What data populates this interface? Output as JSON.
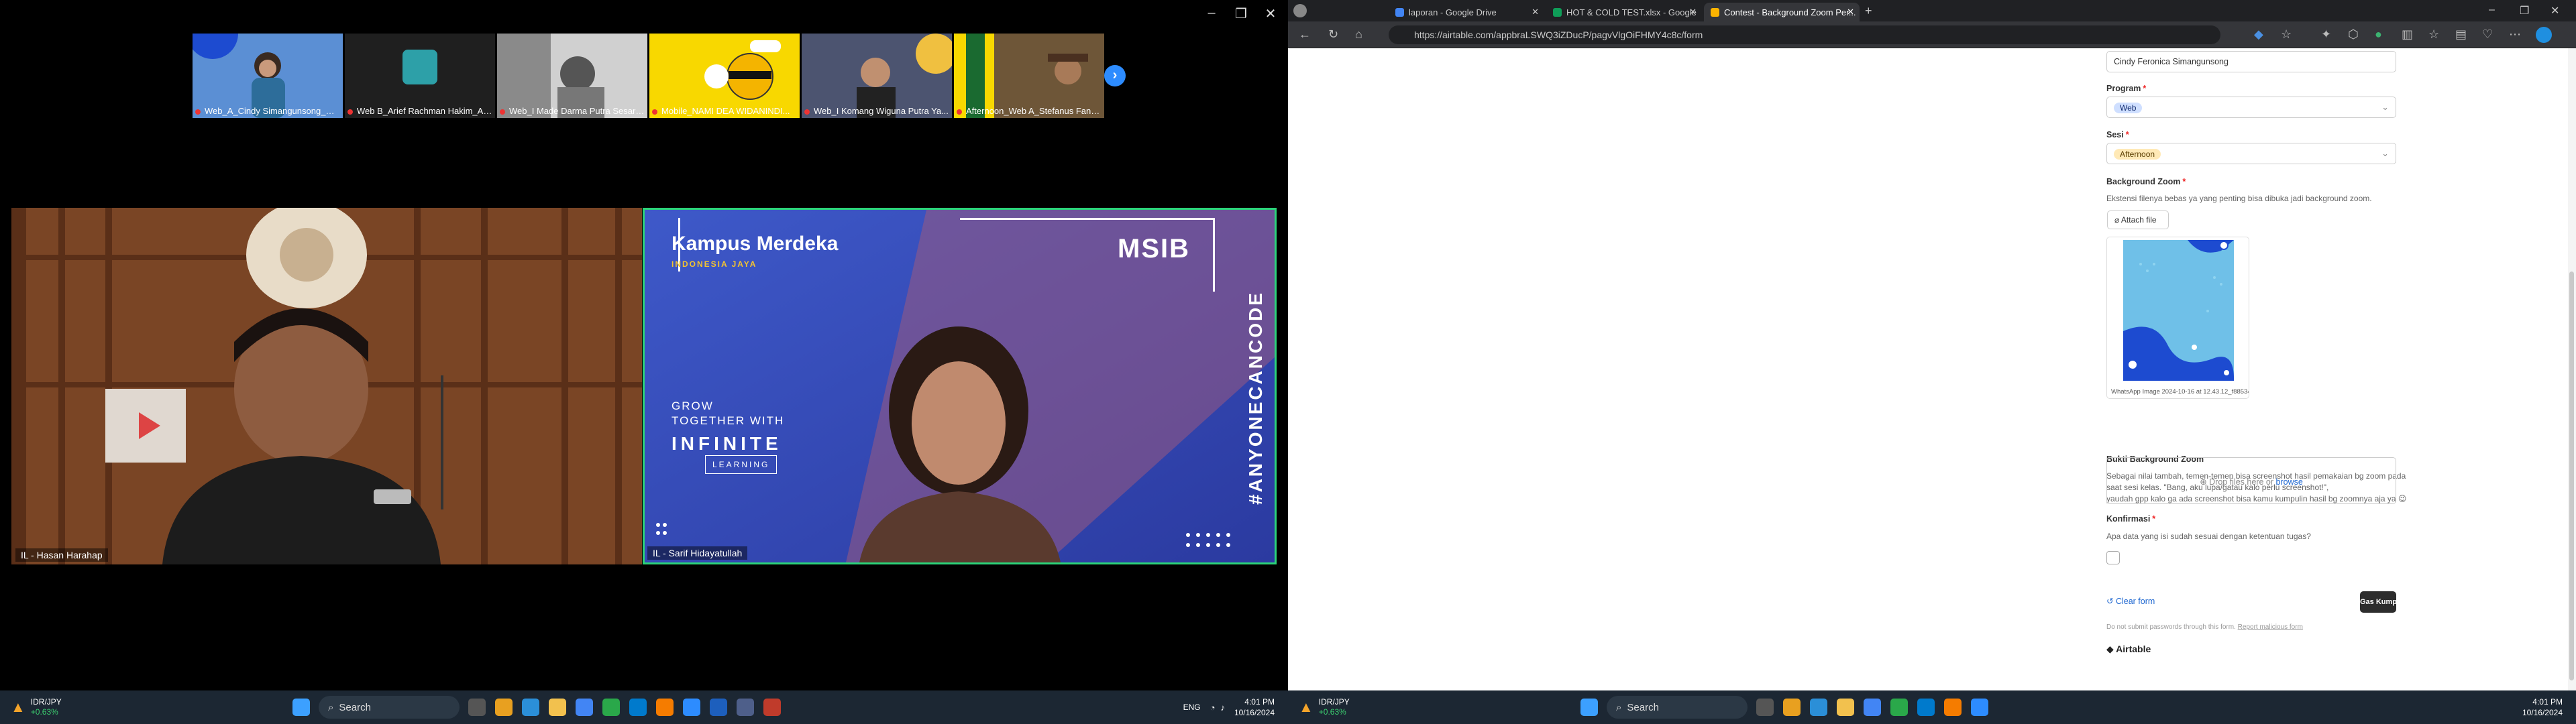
{
  "zoom": {
    "participants": [
      {
        "name": "Web_A_Cindy Simangunsong_Aft..."
      },
      {
        "name": "Web B_Arief Rachman Hakim_Aft..."
      },
      {
        "name": "Web_I Made Darma Putra Sesari..."
      },
      {
        "name": "Mobile_NAMI DEA WIDANINDI..."
      },
      {
        "name": "Web_I Komang Wiguna Putra Ya..."
      },
      {
        "name": "Afternoon_Web A_Stefanus Fandi..."
      }
    ],
    "left_speaker": "IL - Hasan Harahap",
    "right_speaker": "IL - Sarif Hidayatullah",
    "slide": {
      "brand_top": "Kampus Merdeka",
      "brand_sub": "INDONESIA JAYA",
      "msib": "MSIB",
      "grow": "GROW",
      "together": "TOGETHER WITH",
      "infinite": "INFINITE",
      "learning": "LEARNING",
      "hashtag": "#ANYONECANCODE"
    },
    "nameplate": "Hasan Harahap"
  },
  "taskbar_left": {
    "ticker": "IDR/JPY",
    "change": "+0.63%",
    "search": "Search",
    "lang": "ENG",
    "time": "4:01 PM",
    "date": "10/16/2024"
  },
  "taskbar_right": {
    "ticker": "IDR/JPY",
    "change": "+0.63%",
    "search": "Search",
    "time": "4:01 PM",
    "date": "10/16/2024"
  },
  "browser": {
    "tabs": [
      {
        "title": "laporan - Google Drive",
        "active": false,
        "color": "#4285f4"
      },
      {
        "title": "HOT & COLD TEST.xlsx - Google",
        "active": false,
        "color": "#0f9d58"
      },
      {
        "title": "Contest - Background Zoom Per...",
        "active": true,
        "color": "#fcb400"
      }
    ],
    "url": "https://airtable.com/appbraLSWQ3iZDucP/pagvVlgOiFHMY4c8c/form"
  },
  "form": {
    "name_value": "Cindy Feronica Simangunsong",
    "program_label": "Program",
    "program_value": "Web",
    "sesi_label": "Sesi",
    "sesi_value": "Afternoon",
    "bgzoom_label": "Background Zoom",
    "bgzoom_desc": "Ekstensi filenya bebas ya yang penting bisa dibuka jadi background zoom.",
    "attach_label": "Attach file",
    "attachment_name": "WhatsApp Image 2024-10-16 at 12.43.12_f8853448.jpg",
    "bukti_label": "Bukti Background Zoom",
    "bukti_desc1": "Sebagai nilai tambah, temen-temen bisa screenshot hasil pemakaian bg zoom pada saat sesi kelas. \"Bang, aku lupa/gatau kalo perlu screenshot!\",",
    "bukti_desc2": "yaudah gpp kalo ga ada screenshot bisa kamu kumpulin hasil bg zoomnya aja ya 😉",
    "drop_text": "Drop files here or",
    "browse": "browse",
    "konfirmasi_label": "Konfirmasi",
    "konfirmasi_desc": "Apa data yang isi sudah sesuai dengan ketentuan tugas?",
    "clear": "Clear form",
    "submit": "Gas Kumpulin",
    "footer_note": "Do not submit passwords through this form.",
    "report": "Report malicious form",
    "brand": "Airtable"
  }
}
